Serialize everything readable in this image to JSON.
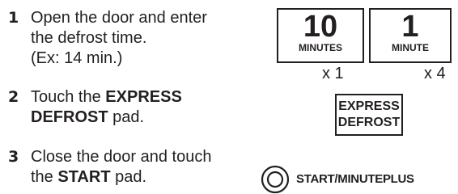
{
  "steps": [
    {
      "number": "1",
      "line1": "Open the door and enter",
      "line2": "the defrost time.",
      "line3": "(Ex: 14 min.)"
    },
    {
      "number": "2",
      "prefix": "Touch the ",
      "bold1": "EXPRESS",
      "bold2": "DEFROST",
      "suffix": " pad."
    },
    {
      "number": "3",
      "line1": "Close the door and touch",
      "prefix": "the ",
      "bold": "START",
      "suffix": " pad."
    }
  ],
  "pads": {
    "ten_minutes": {
      "number": "10",
      "label": "MINUTES",
      "multiplier": "x 1"
    },
    "one_minute": {
      "number": "1",
      "label": "MINUTE",
      "multiplier": "x 4"
    },
    "express_defrost": {
      "line1": "EXPRESS",
      "line2": "DEFROST"
    },
    "start": {
      "label": "START/MINUTEPLUS",
      "icon": "start-circle-icon"
    }
  }
}
